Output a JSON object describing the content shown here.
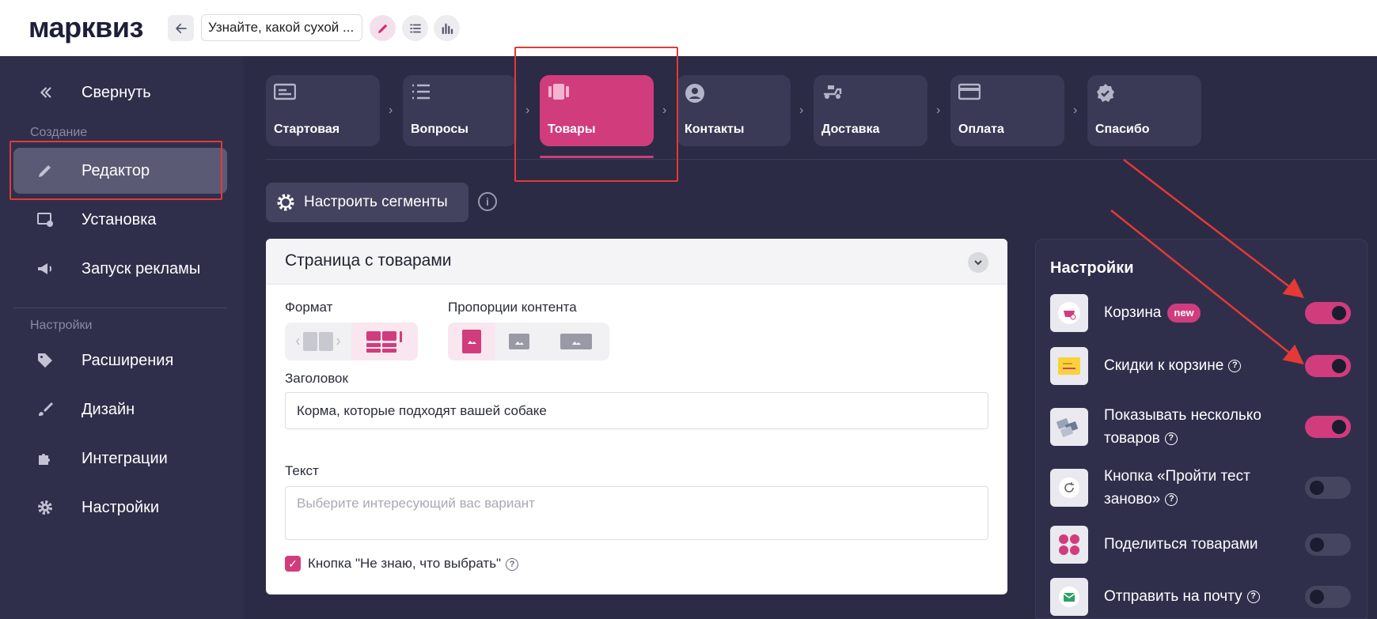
{
  "topbar": {
    "logo": "марквиз",
    "back_icon": "arrow-left-icon",
    "quiz_title": "Узнайте, какой сухой ...",
    "edit_icon": "pencil-icon",
    "list_icon": "list-icon",
    "stats_icon": "bar-chart-icon"
  },
  "sidebar": {
    "collapse_label": "Свернуть",
    "section_create": "Создание",
    "section_settings": "Настройки",
    "items": [
      {
        "label": "Редактор",
        "icon": "pencil-icon"
      },
      {
        "label": "Установка",
        "icon": "install-icon"
      },
      {
        "label": "Запуск рекламы",
        "icon": "megaphone-icon"
      },
      {
        "label": "Расширения",
        "icon": "tag-plus-icon"
      },
      {
        "label": "Дизайн",
        "icon": "brush-icon"
      },
      {
        "label": "Интеграции",
        "icon": "puzzle-plus-icon"
      },
      {
        "label": "Настройки",
        "icon": "gear-icon"
      }
    ]
  },
  "steps": [
    {
      "label": "Стартовая",
      "icon": "start-page-icon"
    },
    {
      "label": "Вопросы",
      "icon": "questions-list-icon"
    },
    {
      "label": "Товары",
      "icon": "products-icon"
    },
    {
      "label": "Контакты",
      "icon": "contact-icon"
    },
    {
      "label": "Доставка",
      "icon": "delivery-icon"
    },
    {
      "label": "Оплата",
      "icon": "card-icon"
    },
    {
      "label": "Спасибо",
      "icon": "badge-check-icon"
    }
  ],
  "segments": {
    "button_label": "Настроить сегменты",
    "info_symbol": "i"
  },
  "products_card": {
    "title": "Страница с товарами",
    "format_label": "Формат",
    "proportions_label": "Пропорции контента",
    "heading_label": "Заголовок",
    "heading_value": "Корма, которые подходят вашей собаке",
    "text_label": "Текст",
    "text_placeholder": "Выберите интересующий вас вариант",
    "checkbox_label": "Кнопка \"Не знаю, что выбрать\"",
    "checkbox_checked": true
  },
  "settings": {
    "title": "Настройки",
    "new_badge": "new",
    "help_symbol": "?",
    "rows": [
      {
        "label": "Корзина",
        "on": true
      },
      {
        "label": "Скидки к корзине",
        "on": true
      },
      {
        "label": "Показывать несколько товаров",
        "on": true
      },
      {
        "label": "Кнопка «Пройти тест заново»",
        "on": false
      },
      {
        "label": "Поделиться товарами",
        "on": false
      },
      {
        "label": "Отправить на почту",
        "on": false
      }
    ]
  },
  "colors": {
    "accent": "#d13c7d",
    "sidebar_bg": "#2f2f4b",
    "main_bg": "#2b2b45",
    "annotation": "#e53935"
  }
}
